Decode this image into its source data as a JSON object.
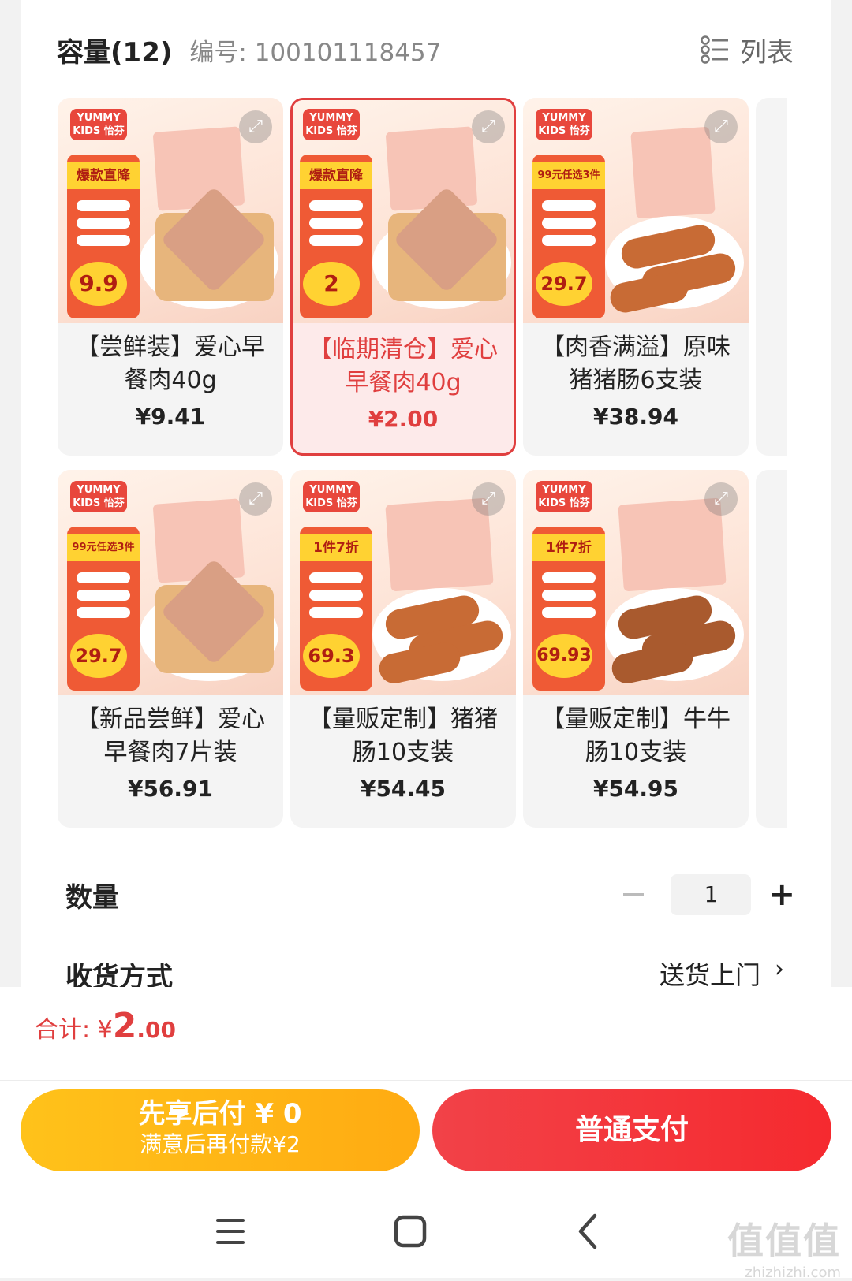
{
  "header": {
    "capacity_label": "容量(12)",
    "sku_label": "编号: 100101118457",
    "list_toggle_label": "列表",
    "list_icon": "list-view-icon"
  },
  "products": [
    {
      "name": "【尝鲜装】爱心早餐肉40g",
      "price": "¥9.41",
      "selected": false,
      "promo_tag": "爆款直降",
      "badge_price": "9.9",
      "image": "heart-luncheon-meat-sandwich"
    },
    {
      "name": "【临期清仓】爱心早餐肉40g",
      "price": "¥2.00",
      "selected": true,
      "promo_tag": "爆款直降",
      "badge_price": "2",
      "image": "heart-luncheon-meat-sandwich"
    },
    {
      "name": "【肉香满溢】原味猪猪肠6支装",
      "price": "¥38.94",
      "selected": false,
      "promo_tag": "99元任选3件",
      "badge_price": "29.7",
      "image": "pork-sausages-plate"
    },
    {
      "name": "【新品尝鲜】爱心早餐肉7片装",
      "price": "¥56.91",
      "selected": false,
      "promo_tag": "99元任选3件",
      "badge_price": "29.7",
      "image": "heart-luncheon-meat-sandwich"
    },
    {
      "name": "【量贩定制】猪猪肠10支装",
      "price": "¥54.45",
      "selected": false,
      "promo_tag": "1件7折",
      "badge_price": "69.3",
      "image": "pork-sausages-plate"
    },
    {
      "name": "【量贩定制】牛牛肠10支装",
      "price": "¥54.95",
      "selected": false,
      "promo_tag": "1件7折",
      "badge_price": "69.93",
      "image": "beef-sausages-plate"
    }
  ],
  "brand_badge": "YUMMY KIDS 怡芬",
  "quantity": {
    "label": "数量",
    "value": "1",
    "minus_icon": "minus-icon",
    "plus_icon": "plus-icon"
  },
  "shipping": {
    "label": "收货方式",
    "value": "送货上门",
    "chevron": "›"
  },
  "footer": {
    "total_label": "合计:",
    "total_currency": "¥",
    "total_int": "2",
    "total_dec": ".00",
    "pay_later_line1": "先享后付 ¥ 0",
    "pay_later_line2": "满意后再付款¥2",
    "pay_normal": "普通支付"
  },
  "watermark": {
    "logo": "值值值",
    "url": "zhizhizhi.com"
  },
  "colors": {
    "accent_red": "#e03f3f",
    "pay_yellow": "#ffb817",
    "pay_red": "#f3373c"
  }
}
